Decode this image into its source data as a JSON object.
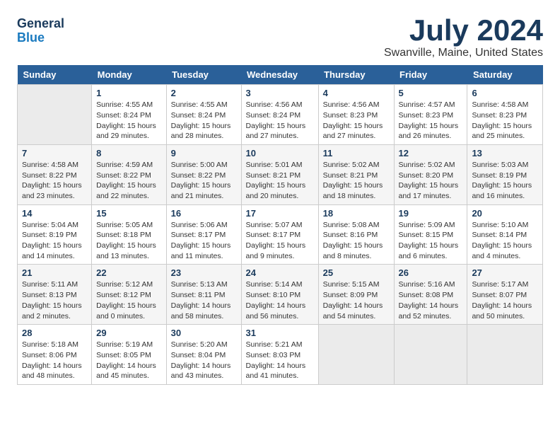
{
  "header": {
    "logo_line1": "General",
    "logo_line2": "Blue",
    "month": "July 2024",
    "location": "Swanville, Maine, United States"
  },
  "weekdays": [
    "Sunday",
    "Monday",
    "Tuesday",
    "Wednesday",
    "Thursday",
    "Friday",
    "Saturday"
  ],
  "weeks": [
    [
      {
        "day": "",
        "info": ""
      },
      {
        "day": "1",
        "info": "Sunrise: 4:55 AM\nSunset: 8:24 PM\nDaylight: 15 hours\nand 29 minutes."
      },
      {
        "day": "2",
        "info": "Sunrise: 4:55 AM\nSunset: 8:24 PM\nDaylight: 15 hours\nand 28 minutes."
      },
      {
        "day": "3",
        "info": "Sunrise: 4:56 AM\nSunset: 8:24 PM\nDaylight: 15 hours\nand 27 minutes."
      },
      {
        "day": "4",
        "info": "Sunrise: 4:56 AM\nSunset: 8:23 PM\nDaylight: 15 hours\nand 27 minutes."
      },
      {
        "day": "5",
        "info": "Sunrise: 4:57 AM\nSunset: 8:23 PM\nDaylight: 15 hours\nand 26 minutes."
      },
      {
        "day": "6",
        "info": "Sunrise: 4:58 AM\nSunset: 8:23 PM\nDaylight: 15 hours\nand 25 minutes."
      }
    ],
    [
      {
        "day": "7",
        "info": "Sunrise: 4:58 AM\nSunset: 8:22 PM\nDaylight: 15 hours\nand 23 minutes."
      },
      {
        "day": "8",
        "info": "Sunrise: 4:59 AM\nSunset: 8:22 PM\nDaylight: 15 hours\nand 22 minutes."
      },
      {
        "day": "9",
        "info": "Sunrise: 5:00 AM\nSunset: 8:22 PM\nDaylight: 15 hours\nand 21 minutes."
      },
      {
        "day": "10",
        "info": "Sunrise: 5:01 AM\nSunset: 8:21 PM\nDaylight: 15 hours\nand 20 minutes."
      },
      {
        "day": "11",
        "info": "Sunrise: 5:02 AM\nSunset: 8:21 PM\nDaylight: 15 hours\nand 18 minutes."
      },
      {
        "day": "12",
        "info": "Sunrise: 5:02 AM\nSunset: 8:20 PM\nDaylight: 15 hours\nand 17 minutes."
      },
      {
        "day": "13",
        "info": "Sunrise: 5:03 AM\nSunset: 8:19 PM\nDaylight: 15 hours\nand 16 minutes."
      }
    ],
    [
      {
        "day": "14",
        "info": "Sunrise: 5:04 AM\nSunset: 8:19 PM\nDaylight: 15 hours\nand 14 minutes."
      },
      {
        "day": "15",
        "info": "Sunrise: 5:05 AM\nSunset: 8:18 PM\nDaylight: 15 hours\nand 13 minutes."
      },
      {
        "day": "16",
        "info": "Sunrise: 5:06 AM\nSunset: 8:17 PM\nDaylight: 15 hours\nand 11 minutes."
      },
      {
        "day": "17",
        "info": "Sunrise: 5:07 AM\nSunset: 8:17 PM\nDaylight: 15 hours\nand 9 minutes."
      },
      {
        "day": "18",
        "info": "Sunrise: 5:08 AM\nSunset: 8:16 PM\nDaylight: 15 hours\nand 8 minutes."
      },
      {
        "day": "19",
        "info": "Sunrise: 5:09 AM\nSunset: 8:15 PM\nDaylight: 15 hours\nand 6 minutes."
      },
      {
        "day": "20",
        "info": "Sunrise: 5:10 AM\nSunset: 8:14 PM\nDaylight: 15 hours\nand 4 minutes."
      }
    ],
    [
      {
        "day": "21",
        "info": "Sunrise: 5:11 AM\nSunset: 8:13 PM\nDaylight: 15 hours\nand 2 minutes."
      },
      {
        "day": "22",
        "info": "Sunrise: 5:12 AM\nSunset: 8:12 PM\nDaylight: 15 hours\nand 0 minutes."
      },
      {
        "day": "23",
        "info": "Sunrise: 5:13 AM\nSunset: 8:11 PM\nDaylight: 14 hours\nand 58 minutes."
      },
      {
        "day": "24",
        "info": "Sunrise: 5:14 AM\nSunset: 8:10 PM\nDaylight: 14 hours\nand 56 minutes."
      },
      {
        "day": "25",
        "info": "Sunrise: 5:15 AM\nSunset: 8:09 PM\nDaylight: 14 hours\nand 54 minutes."
      },
      {
        "day": "26",
        "info": "Sunrise: 5:16 AM\nSunset: 8:08 PM\nDaylight: 14 hours\nand 52 minutes."
      },
      {
        "day": "27",
        "info": "Sunrise: 5:17 AM\nSunset: 8:07 PM\nDaylight: 14 hours\nand 50 minutes."
      }
    ],
    [
      {
        "day": "28",
        "info": "Sunrise: 5:18 AM\nSunset: 8:06 PM\nDaylight: 14 hours\nand 48 minutes."
      },
      {
        "day": "29",
        "info": "Sunrise: 5:19 AM\nSunset: 8:05 PM\nDaylight: 14 hours\nand 45 minutes."
      },
      {
        "day": "30",
        "info": "Sunrise: 5:20 AM\nSunset: 8:04 PM\nDaylight: 14 hours\nand 43 minutes."
      },
      {
        "day": "31",
        "info": "Sunrise: 5:21 AM\nSunset: 8:03 PM\nDaylight: 14 hours\nand 41 minutes."
      },
      {
        "day": "",
        "info": ""
      },
      {
        "day": "",
        "info": ""
      },
      {
        "day": "",
        "info": ""
      }
    ]
  ]
}
